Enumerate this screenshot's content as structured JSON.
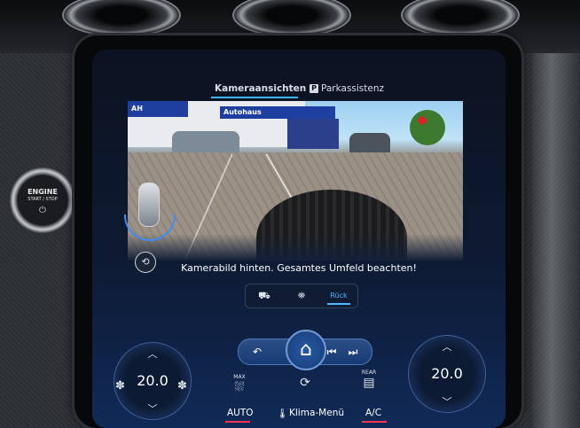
{
  "scene": {
    "engine_button": {
      "line1": "ENGINE",
      "line2": "START / STOP",
      "icon": "power-icon"
    }
  },
  "screen": {
    "tabs": [
      {
        "label": "Kameraansichten",
        "active": true
      },
      {
        "label": "Parkassistenz",
        "icon": "parking-icon",
        "active": false
      }
    ],
    "camera_view": {
      "banner_text": "Autohaus",
      "banner_logo": "AH"
    },
    "message": "Kamerabild hinten. Gesamtes Umfeld beachten!",
    "view_switcher": {
      "items": [
        {
          "name": "surround-view",
          "icon": "car-360-icon"
        },
        {
          "name": "top-view",
          "icon": "car-top-icon"
        },
        {
          "name": "rear-view",
          "label": "Rück",
          "active": true
        }
      ]
    },
    "climate": {
      "left_temp": "20.0",
      "right_temp": "20.0",
      "unit_marker": "°",
      "bottom_labels": {
        "auto": "AUTO",
        "klima": "Klima-Menü",
        "ac": "A/C"
      },
      "center_icons": [
        "max-defrost-icon",
        "recirculation-icon",
        "rear-defrost-icon"
      ],
      "max_label": "MAX",
      "rear_label": "REAR"
    },
    "nav": {
      "icons": [
        "back-icon",
        "home-icon",
        "previous-track-icon",
        "next-track-icon"
      ]
    },
    "colors": {
      "accent_blue": "#3fb3ff",
      "alert_red": "#ff3552"
    }
  }
}
